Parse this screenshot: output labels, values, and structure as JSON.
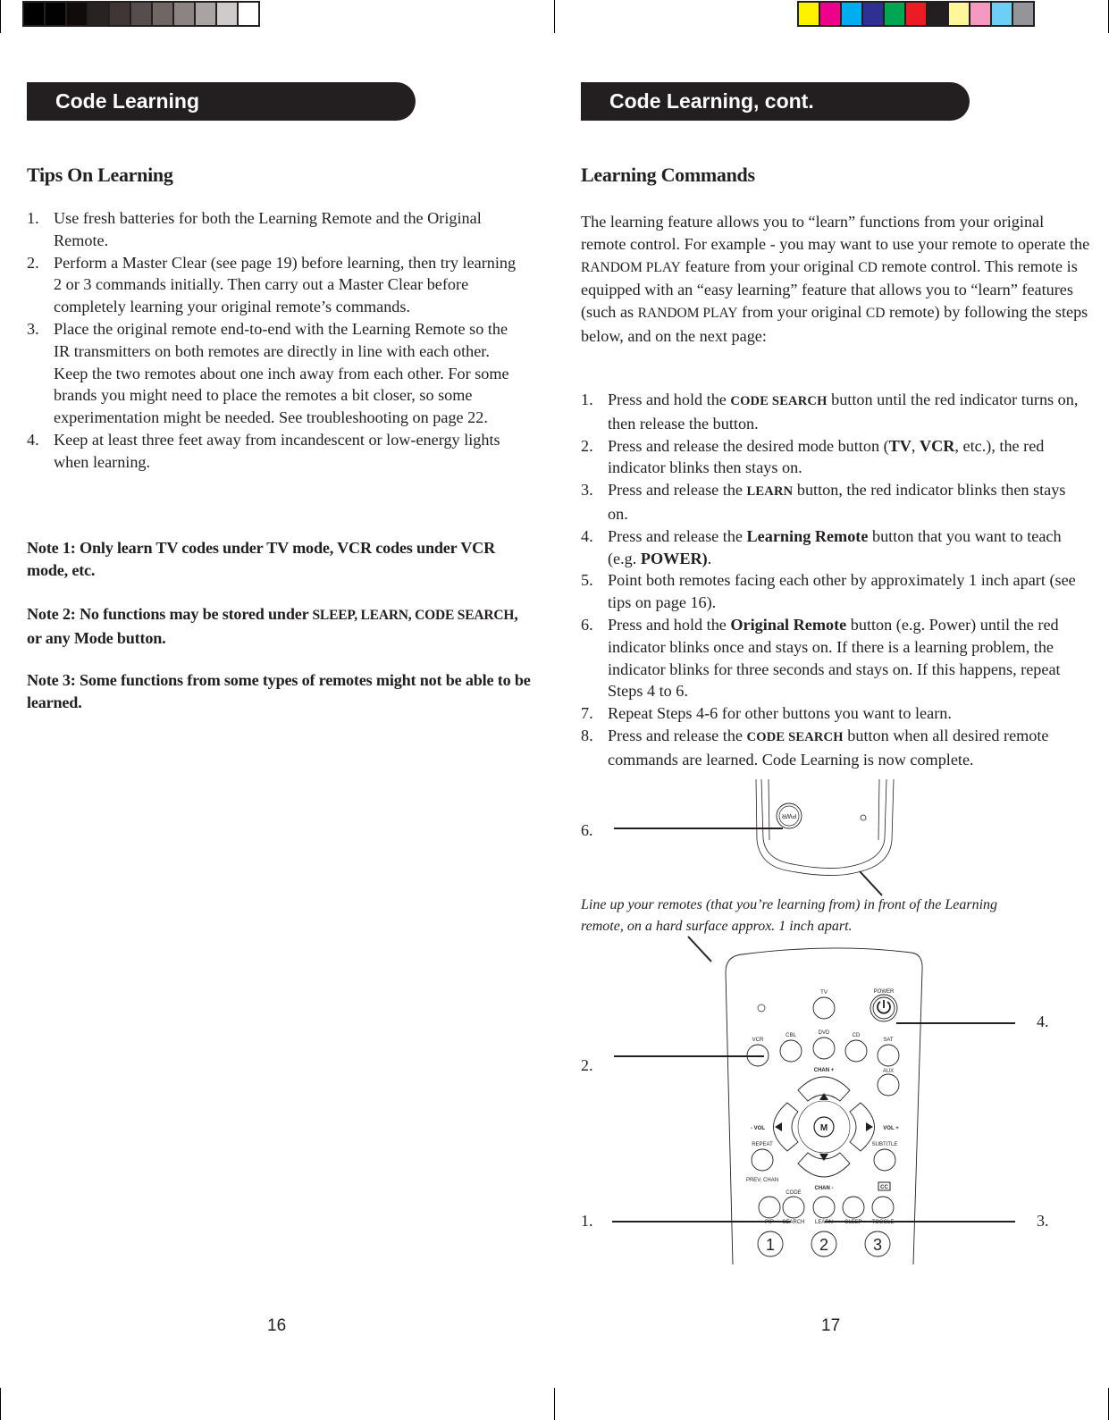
{
  "print_marks": {
    "grayscale_swatches": [
      "#000000",
      "#020202",
      "#110c09",
      "#282321",
      "#3e3735",
      "#564e4c",
      "#6f6764",
      "#8b8482",
      "#a9a4a1",
      "#cfcbca",
      "#ffffff"
    ],
    "color_swatches": [
      "#fff200",
      "#ec008c",
      "#00aeef",
      "#2e3192",
      "#00a651",
      "#ed1c24",
      "#231f20",
      "#fff799",
      "#f49ac1",
      "#6dcff6",
      "#939598"
    ]
  },
  "left_page": {
    "banner_title": "Code Learning",
    "section_title": "Tips On Learning",
    "tips": [
      {
        "num": "1.",
        "text": "Use fresh batteries for both the Learning Remote and the Original Remote."
      },
      {
        "num": "2.",
        "text": "Perform a Master Clear (see page 19) before learning, then try learning 2 or 3 commands initially. Then carry out a Master Clear before completely learning your original remote’s commands."
      },
      {
        "num": "3.",
        "text": "Place the original remote end-to-end with the  Learning Remote so the IR transmitters on both remotes are directly in line with each other. Keep the two remotes about one inch away from each other. For some brands you might need to place the remotes a bit closer, so some experimentation might be needed. See troubleshooting on page 22."
      },
      {
        "num": "4.",
        "text": "Keep at least three feet away from incandescent or low-energy lights when learning."
      }
    ],
    "notes": [
      {
        "lead": "Note 1: Only learn TV codes under TV mode, VCR codes under VCR mode, etc.",
        "caps": "",
        "tail": ""
      },
      {
        "lead": "Note 2:  No functions may be stored under ",
        "caps": "SLEEP, LEARN, CODE SEARCH",
        "tail": ", or any Mode button."
      },
      {
        "lead": "Note 3:  Some functions from some types of remotes might not be able to be learned.",
        "caps": "",
        "tail": ""
      }
    ],
    "page_number": "16"
  },
  "right_page": {
    "banner_title": "Code Learning, cont.",
    "section_title": "Learning Commands",
    "intro": {
      "p1": "The learning feature allows you to “learn” functions from your original remote control. For example - you may want to use your remote to operate the ",
      "k1": "RANDOM PLAY",
      "p2": " feature from your original ",
      "k2": "CD",
      "p3": " remote control. This remote is equipped with an “easy learning” feature that allows you to “learn” features (such as ",
      "k3": "RANDOM PLAY",
      "p4": " from your original ",
      "k4": "CD",
      "p5": " remote) by following the steps below, and on the next page:"
    },
    "steps": [
      {
        "num": "1.",
        "a": "Press and hold the ",
        "b": "CODE SEARCH",
        "c": " button until the red indicator turns on, then release the button."
      },
      {
        "num": "2.",
        "a": "Press and release the desired mode button (",
        "b": "TV",
        "c": ", ",
        "d": "VCR",
        "e": ", etc.), the red indicator blinks then stays on."
      },
      {
        "num": "3.",
        "a": "Press and release the ",
        "b": "LEARN",
        "c": " button, the red indicator blinks then  stays  on."
      },
      {
        "num": "4.",
        "a": "Press and release the ",
        "b": "Learning Remote",
        "c": " button that you want to teach (e.g. ",
        "d": "POWER)",
        "e": "."
      },
      {
        "num": "5.",
        "a": "Point both remotes facing each other by approximately 1 inch apart (see tips on page 16)."
      },
      {
        "num": "6.",
        "a": "Press and hold the ",
        "b": "Original Remote",
        "c": " button (e.g. Power) until the red indicator blinks once and stays on. If there is a learning problem, the indicator blinks for three seconds and stays on. If this happens, repeat Steps 4 to 6."
      },
      {
        "num": "7.",
        "a": "Repeat Steps 4-6 for other buttons you want to learn."
      },
      {
        "num": "8.",
        "a": "Press and release the ",
        "b": "CODE SEARCH",
        "c": " button when all desired remote commands are learned. Code Learning is now complete."
      }
    ],
    "figure": {
      "caption": "Line up your remotes (that you’re learning from) in front of the Learning remote, on a hard surface approx. 1 inch apart.",
      "callouts": {
        "c6": "6.",
        "c2": "2.",
        "c4": "4.",
        "c1": "1.",
        "c3": "3."
      },
      "original_remote": {
        "pwr_label": "PWR"
      },
      "learning_remote": {
        "tv": "TV",
        "power": "POWER",
        "vcr": "VCR",
        "cbl": "CBL",
        "dvd": "DVD",
        "cd": "CD",
        "sat": "SAT",
        "aux": "AUX",
        "chan_up": "CHAN +",
        "chan_down": "CHAN -",
        "vol_down": "- VOL",
        "vol_up": "VOL +",
        "menu": "M",
        "repeat": "REPEAT",
        "prev_chan": "PREV. CHAN",
        "subtitle": "SUBTITLE",
        "cc": "CC",
        "code": "CODE",
        "pip": "PIP",
        "search": "SEARCH",
        "learn": "LEARN",
        "sleep": "SLEEP",
        "toggle": "TOGGLE",
        "n1": "1",
        "n2": "2",
        "n3": "3"
      }
    },
    "page_number": "17"
  }
}
